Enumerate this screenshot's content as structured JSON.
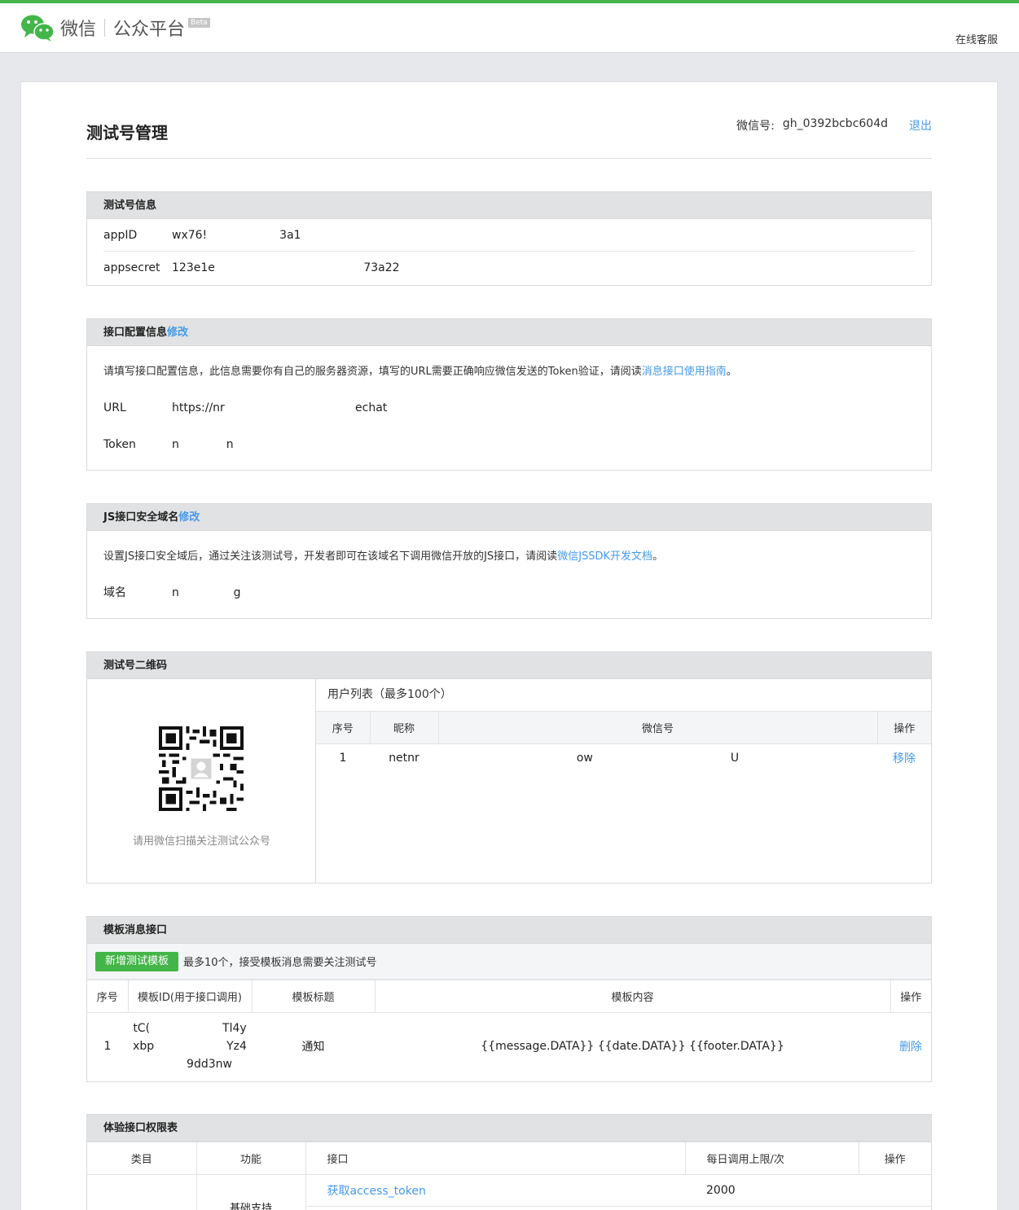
{
  "colors": {
    "brand_green": "#44b549",
    "link_blue": "#459ae9"
  },
  "topbar": {
    "logo_wechat": "微信",
    "logo_platform": "公众平台",
    "beta": "Beta",
    "service": "在线客服"
  },
  "page": {
    "title": "测试号管理",
    "account_label": "微信号:",
    "account_value": "gh_0392bcbc604d",
    "logout": "退出"
  },
  "info": {
    "title": "测试号信息",
    "appid_label": "appID",
    "appid_value": "wx76!                    3a1",
    "appsecret_label": "appsecret",
    "appsecret_value": "123e1e                                         73a22"
  },
  "api_config": {
    "title": "接口配置信息",
    "edit": "修改",
    "desc": "请填写接口配置信息，此信息需要你有自己的服务器资源，填写的URL需要正确响应微信发送的Token验证，请阅读",
    "desc_link": "消息接口使用指南",
    "desc_end": "。",
    "url_label": "URL",
    "url_value": "https://nr                                    echat",
    "token_label": "Token",
    "token_value": "n             n"
  },
  "js_domain": {
    "title": "JS接口安全域名",
    "edit": "修改",
    "desc": "设置JS接口安全域后，通过关注该测试号，开发者即可在该域名下调用微信开放的JS接口，请阅读",
    "desc_link": "微信JSSDK开发文档",
    "desc_end": "。",
    "domain_label": "域名",
    "domain_value": "n               g"
  },
  "qrcode": {
    "title": "测试号二维码",
    "caption": "请用微信扫描关注测试公众号",
    "user_list_title": "用户列表（最多100个）",
    "headers": [
      "序号",
      "昵称",
      "微信号",
      "操作"
    ],
    "rows": [
      {
        "no": "1",
        "nick": "netnr",
        "openid": "ow                                      U",
        "action": "移除"
      }
    ]
  },
  "template": {
    "title": "模板消息接口",
    "add_button": "新增测试模板",
    "note": "最多10个，接受模板消息需要关注测试号",
    "headers": [
      "序号",
      "模板ID(用于接口调用)",
      "模板标题",
      "模板内容",
      "操作"
    ],
    "rows": [
      {
        "no": "1",
        "id_line1": "tC(                    Tl4y",
        "id_line2": "xbp                    Yz4",
        "id_line3": "9dd3nw",
        "title": "通知",
        "content": "{{message.DATA}} {{date.DATA}} {{footer.DATA}}",
        "action": "删除"
      }
    ]
  },
  "permissions": {
    "title": "体验接口权限表",
    "headers": [
      "类目",
      "功能",
      "接口",
      "每日调用上限/次",
      "操作"
    ],
    "rows": [
      {
        "category": "",
        "function": "基础支持",
        "api": "获取access_token",
        "limit": "2000"
      }
    ]
  }
}
